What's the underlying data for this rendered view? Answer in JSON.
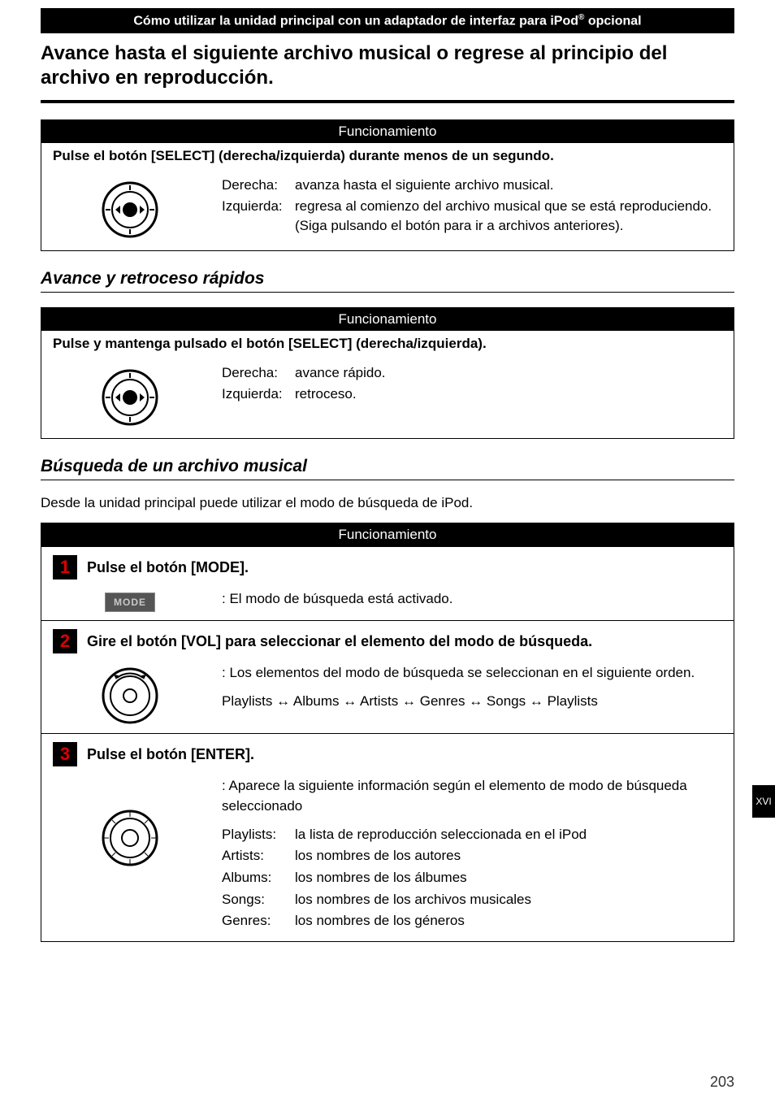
{
  "header": {
    "banner_pre": "Cómo utilizar la unidad principal con un adaptador de interfaz para iPod",
    "banner_sup": "®",
    "banner_post": " opcional",
    "title": "Avance hasta el siguiente archivo musical o regrese al principio del archivo en reproducción."
  },
  "box1": {
    "header": "Funcionamiento",
    "instruction": "Pulse el botón [SELECT] (derecha/izquierda) durante menos de un segundo.",
    "right_label": "Derecha:",
    "right_text": "avanza hasta el siguiente archivo musical.",
    "left_label": "Izquierda:",
    "left_text": "regresa al comienzo del archivo musical que se está reproduciendo. (Siga pulsando el botón para ir a archivos anteriores)."
  },
  "section2_title": "Avance y retroceso rápidos",
  "box2": {
    "header": "Funcionamiento",
    "instruction": "Pulse y mantenga pulsado el botón [SELECT] (derecha/izquierda).",
    "right_label": "Derecha:",
    "right_text": "avance rápido.",
    "left_label": "Izquierda:",
    "left_text": "retroceso."
  },
  "section3_title": "Búsqueda de un archivo musical",
  "section3_intro": "Desde la unidad principal puede utilizar el modo de búsqueda de iPod.",
  "box3": {
    "header": "Funcionamiento",
    "steps": [
      {
        "num": "1",
        "title": "Pulse el botón [MODE].",
        "mode_label": "MODE",
        "desc": ": El modo de búsqueda está activado."
      },
      {
        "num": "2",
        "title": "Gire el botón [VOL] para seleccionar el elemento del modo de búsqueda.",
        "desc_line1": ": Los elementos del modo de búsqueda se seleccionan en el siguiente orden.",
        "desc_line2": "Playlists ↔ Albums ↔ Artists ↔ Genres ↔ Songs ↔ Playlists"
      },
      {
        "num": "3",
        "title": "Pulse el botón [ENTER].",
        "desc_intro": ": Aparece la siguiente información según el elemento de modo de búsqueda seleccionado",
        "items": [
          {
            "k": "Playlists:",
            "v": "la lista de reproducción seleccionada en el iPod"
          },
          {
            "k": "Artists:",
            "v": "los nombres de los autores"
          },
          {
            "k": "Albums:",
            "v": "los nombres de los álbumes"
          },
          {
            "k": "Songs:",
            "v": "los nombres de los archivos musicales"
          },
          {
            "k": "Genres:",
            "v": "los nombres de los géneros"
          }
        ]
      }
    ]
  },
  "side_tab": "XVI",
  "page_number": "203"
}
